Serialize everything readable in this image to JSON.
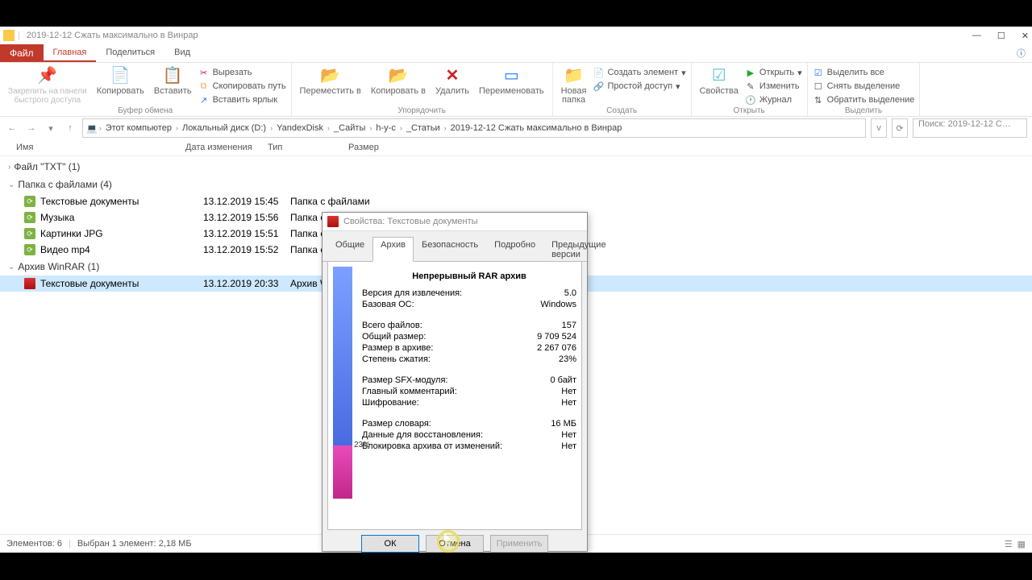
{
  "window": {
    "title": "2019-12-12 Сжать максимально в Винрар",
    "minimize": "—",
    "maximize": "☐",
    "close": "✕"
  },
  "ribbonTabs": {
    "file": "Файл",
    "home": "Главная",
    "share": "Поделиться",
    "view": "Вид",
    "help": "?"
  },
  "ribbon": {
    "pin": "Закрепить на панели\nбыстрого доступа",
    "copy": "Копировать",
    "paste": "Вставить",
    "cut": "Вырезать",
    "copypath": "Скопировать путь",
    "shortcut": "Вставить ярлык",
    "move": "Переместить в",
    "copyto": "Копировать в",
    "delete": "Удалить",
    "rename": "Переименовать",
    "newfolder": "Новая\nпапка",
    "newitem": "Создать элемент",
    "easyaccess": "Простой доступ",
    "properties": "Свойства",
    "open": "Открыть",
    "edit": "Изменить",
    "history": "Журнал",
    "selectall": "Выделить все",
    "selectnone": "Снять выделение",
    "invert": "Обратить выделение",
    "g_clipboard": "Буфер обмена",
    "g_organize": "Упорядочить",
    "g_new": "Создать",
    "g_open": "Открыть",
    "g_select": "Выделить"
  },
  "crumbs": [
    "Этот компьютер",
    "Локальный диск (D:)",
    "YandexDisk",
    "_Сайты",
    "h-y-c",
    "_Статьи",
    "2019-12-12 Сжать максимально в Винрар"
  ],
  "search": "Поиск: 2019-12-12 С…",
  "columns": {
    "name": "Имя",
    "date": "Дата изменения",
    "type": "Тип",
    "size": "Размер"
  },
  "groups": {
    "txt": "Файл \"TXT\" (1)",
    "folders": "Папка с файлами (4)",
    "rar": "Архив WinRAR (1)"
  },
  "rows": [
    {
      "name": "Текстовые документы",
      "date": "13.12.2019 15:45",
      "type": "Папка с файлами"
    },
    {
      "name": "Музыка",
      "date": "13.12.2019 15:56",
      "type": "Папка с файлами"
    },
    {
      "name": "Картинки JPG",
      "date": "13.12.2019 15:51",
      "type": "Папка с файлами"
    },
    {
      "name": "Видео mp4",
      "date": "13.12.2019 15:52",
      "type": "Папка с файлами"
    }
  ],
  "rarrow": {
    "name": "Текстовые документы",
    "date": "13.12.2019 20:33",
    "type": "Архив WinRAR"
  },
  "status": {
    "count": "Элементов: 6",
    "sel": "Выбран 1 элемент: 2,18 МБ"
  },
  "dialog": {
    "title": "Свойства: Текстовые документы",
    "tabs": {
      "general": "Общие",
      "archive": "Архив",
      "security": "Безопасность",
      "details": "Подробно",
      "prev": "Предыдущие версии"
    },
    "header": "Непрерывный RAR архив",
    "compress_pct": 23,
    "compress_label": "23%",
    "stats": [
      {
        "k": "Версия для извлечения:",
        "v": "5.0"
      },
      {
        "k": "Базовая ОС:",
        "v": "Windows"
      },
      null,
      {
        "k": "Всего файлов:",
        "v": "157"
      },
      {
        "k": "Общий размер:",
        "v": "9 709 524"
      },
      {
        "k": "Размер в архиве:",
        "v": "2 267 076"
      },
      {
        "k": "Степень сжатия:",
        "v": "23%"
      },
      null,
      {
        "k": "Размер SFX-модуля:",
        "v": "0 байт"
      },
      {
        "k": "Главный комментарий:",
        "v": "Нет"
      },
      {
        "k": "Шифрование:",
        "v": "Нет"
      },
      null,
      {
        "k": "Размер словаря:",
        "v": "16 МБ"
      },
      {
        "k": "Данные для восстановления:",
        "v": "Нет"
      },
      {
        "k": "Блокировка архива от изменений:",
        "v": "Нет"
      }
    ],
    "ok": "ОК",
    "cancel": "Отмена",
    "apply": "Применить"
  }
}
